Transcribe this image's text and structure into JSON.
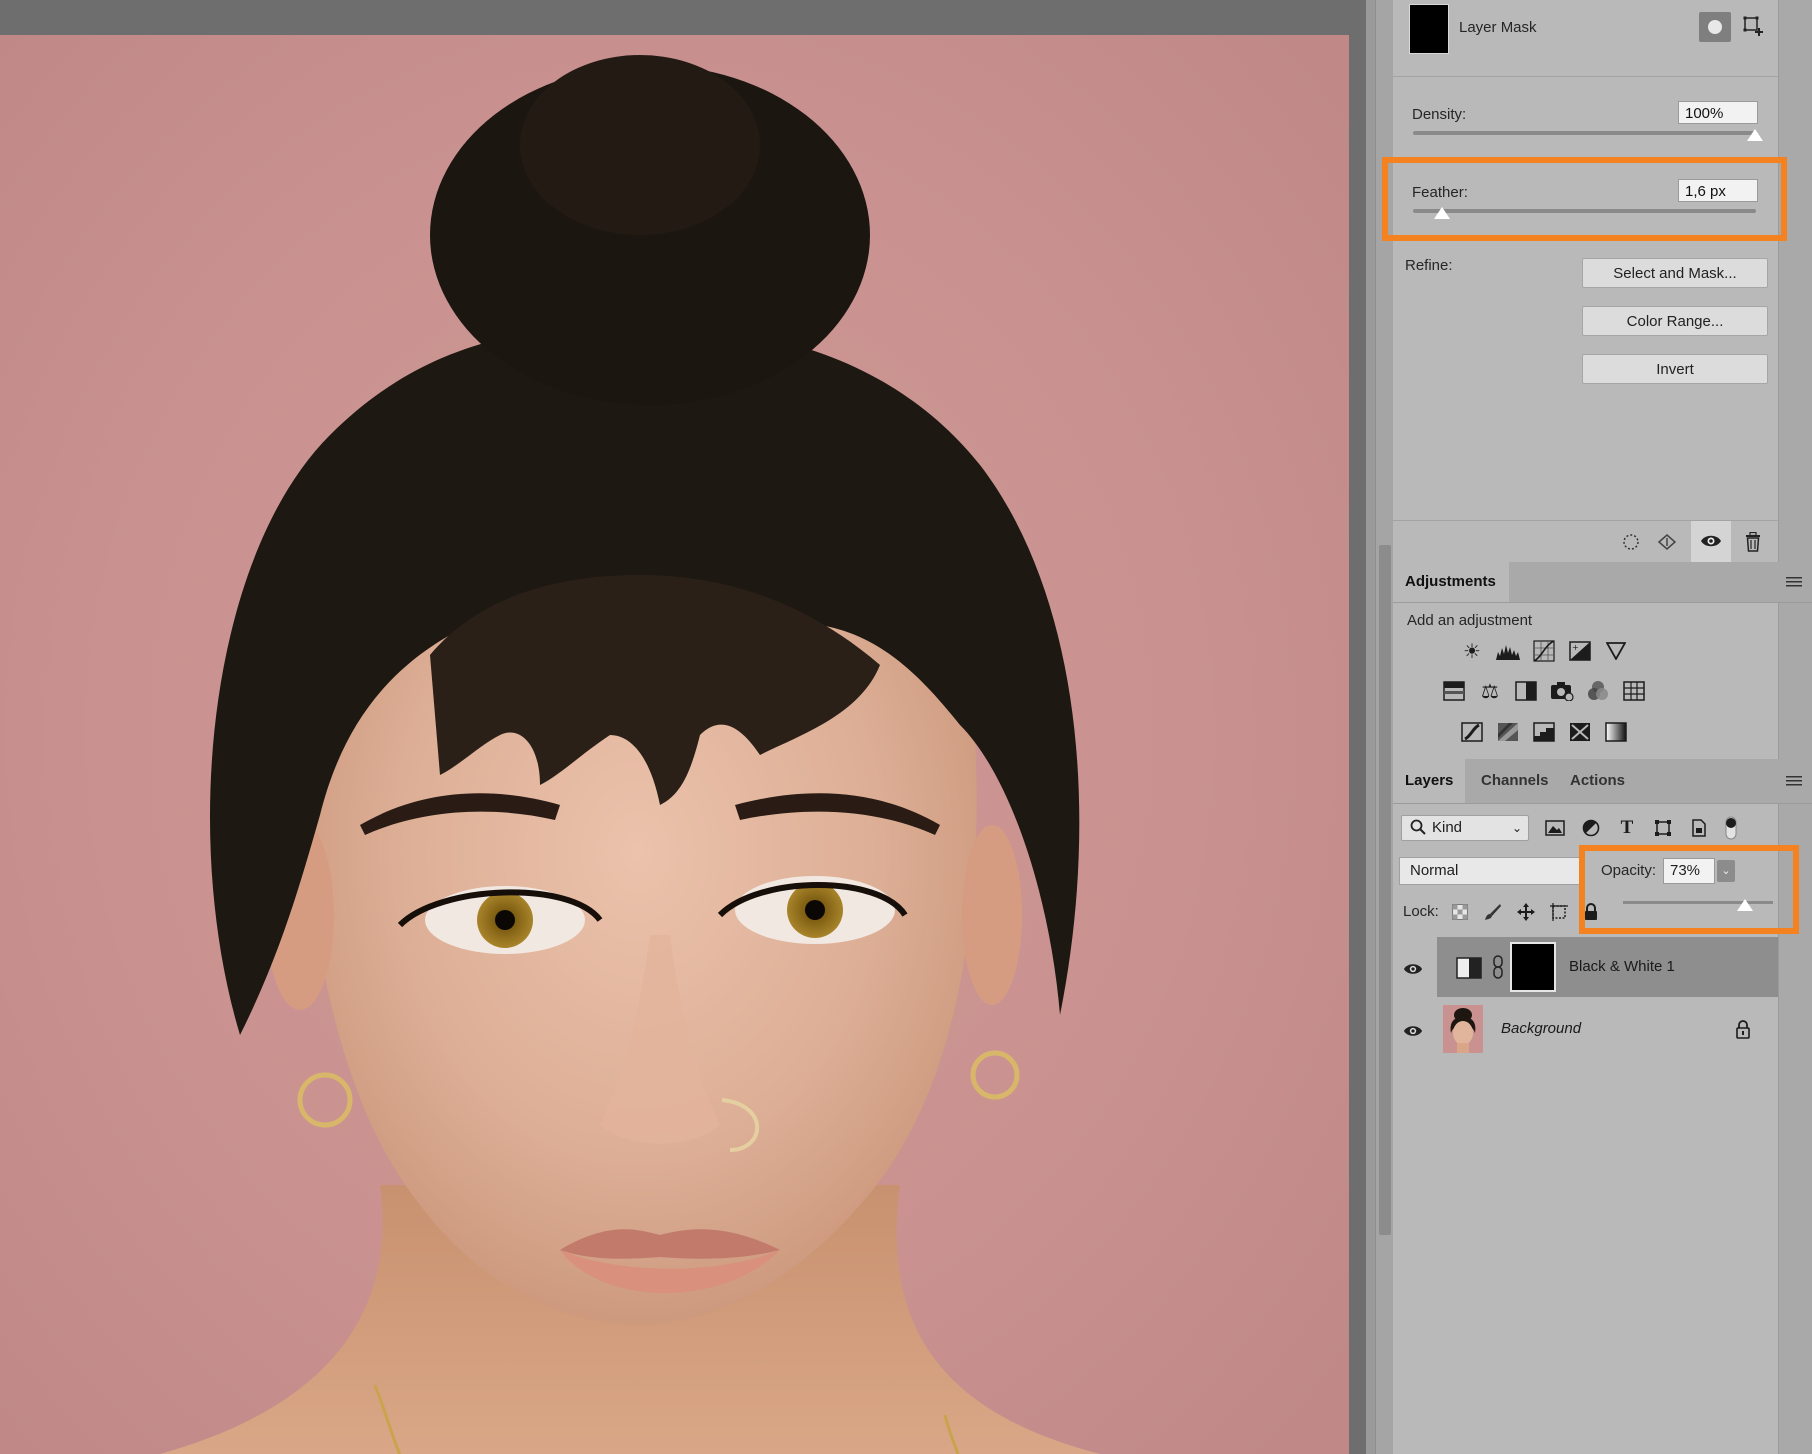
{
  "properties": {
    "title": "Layer Mask",
    "density_label": "Density:",
    "density_value": "100%",
    "density_level": 1.0,
    "feather_label": "Feather:",
    "feather_value": "1,6 px",
    "feather_level": 0.06,
    "refine_label": "Refine:",
    "buttons": {
      "select_and_mask": "Select and Mask...",
      "color_range": "Color Range...",
      "invert": "Invert"
    }
  },
  "adjustments": {
    "tab": "Adjustments",
    "add_label": "Add an adjustment",
    "icons": [
      "brightness-contrast-icon",
      "levels-icon",
      "curves-icon",
      "exposure-icon",
      "vibrance-icon",
      "hue-saturation-icon",
      "color-balance-icon",
      "black-white-icon",
      "photo-filter-icon",
      "channel-mixer-icon",
      "color-lookup-icon",
      "invert-icon",
      "posterize-icon",
      "threshold-icon",
      "selective-color-icon",
      "gradient-map-icon"
    ]
  },
  "layers_panel": {
    "tabs": [
      "Layers",
      "Channels",
      "Actions"
    ],
    "active_tab": "Layers",
    "kind_filter": "Kind",
    "blend_mode": "Normal",
    "opacity_label": "Opacity:",
    "opacity_value": "73%",
    "opacity_level": 0.73,
    "lock_label": "Lock:",
    "layers": [
      {
        "name": "Black & White 1",
        "selected": true
      },
      {
        "name": "Background",
        "selected": false,
        "locked": true
      }
    ]
  },
  "colors": {
    "highlight": "#f58220",
    "panel_bg": "#b9b9b9",
    "selected_layer": "#8e8e8e"
  }
}
